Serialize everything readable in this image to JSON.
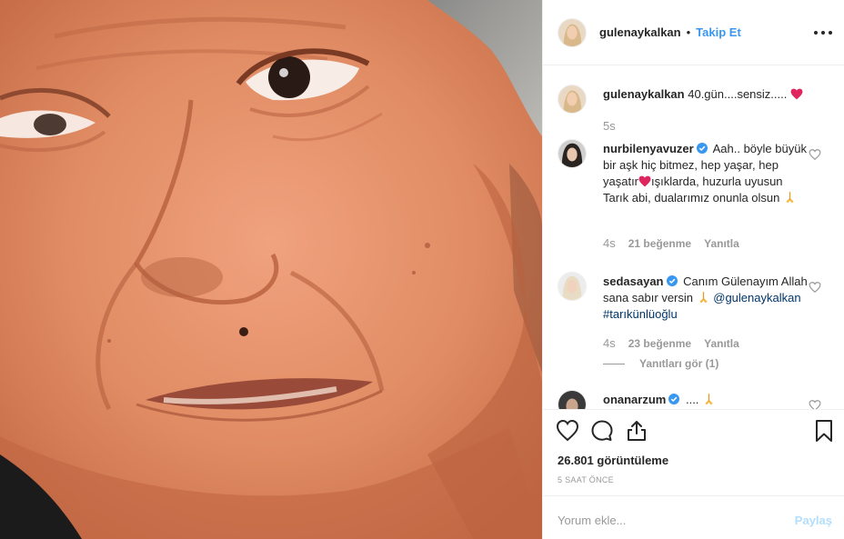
{
  "header": {
    "username": "gulenaykalkan",
    "dot": "•",
    "follow_label": "Takip Et"
  },
  "caption": {
    "username": "gulenaykalkan",
    "text": "40.gün....sensiz.....",
    "age": "5s"
  },
  "comments": [
    {
      "username": "nurbilenyavuzer",
      "verified": true,
      "text_1": "Aah.. böyle büyük bir aşk hiç bitmez, hep yaşar, hep yaşatır",
      "text_2": "ışıklarda, huzurla uyusun Tarık abi, dualarımız onunla olsun",
      "age": "4s",
      "likes": "21 beğenme",
      "reply": "Yanıtla"
    },
    {
      "username": "sedasayan",
      "verified": true,
      "text_1": "Canım Gülenayım Allah sana sabır versin",
      "mention": "@gulenaykalkan",
      "hashtag": "#tarıkünlüoğlu",
      "age": "4s",
      "likes": "23 beğenme",
      "reply": "Yanıtla",
      "view_replies": "Yanıtları gör (1)"
    },
    {
      "username": "onanarzum",
      "verified": true,
      "text_1": "....",
      "age": "",
      "likes": "",
      "reply": ""
    }
  ],
  "stats": {
    "views": "26.801 görüntüleme",
    "time": "5 SAAT ÖNCE"
  },
  "add_comment": {
    "placeholder": "Yorum ekle...",
    "share_label": "Paylaş"
  },
  "colors": {
    "accent": "#3897f0",
    "heart": "#ed4956",
    "verified": "#3897f0"
  }
}
